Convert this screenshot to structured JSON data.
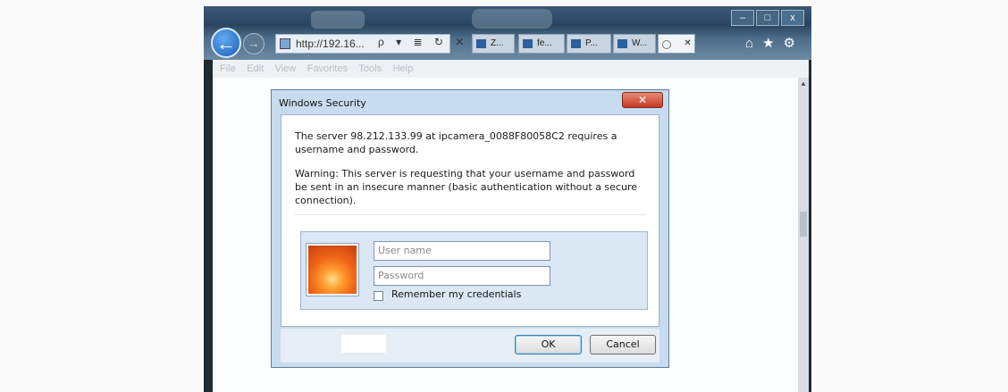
{
  "browser": {
    "address_url": "http://192.16...",
    "address_tools": "ρ ▾ ≣ ↻ ✕",
    "tabs": [
      {
        "label": "Z..."
      },
      {
        "label": "fe..."
      },
      {
        "label": "P..."
      },
      {
        "label": "W..."
      },
      {
        "label": "   ✕"
      }
    ],
    "window_controls": {
      "minimize": "–",
      "maximize": "□",
      "close": "x"
    },
    "menu": [
      "File",
      "Edit",
      "View",
      "Favorites",
      "Tools",
      "Help"
    ]
  },
  "dialog": {
    "title": "Windows Security",
    "message": "The server 98.212.133.99 at ipcamera_0088F80058C2 requires a username and password.",
    "warning": "Warning: This server is requesting that your username and password be sent in an insecure manner (basic authentication without a secure connection).",
    "username_placeholder": "User name",
    "password_placeholder": "Password",
    "remember_label": "Remember my credentials",
    "remember_checked": false,
    "ok_label": "OK",
    "cancel_label": "Cancel"
  },
  "colors": {
    "titlebar": "#2a4560",
    "dialog_frame": "#c7dcef",
    "close_button": "#c53b25",
    "ok_focus": "#3c7fb1"
  },
  "icons": {
    "back": "arrow-left-icon",
    "forward": "arrow-right-icon",
    "home": "home-icon",
    "favorites": "star-icon",
    "tools": "gear-icon",
    "user_tile": "flower-avatar"
  }
}
